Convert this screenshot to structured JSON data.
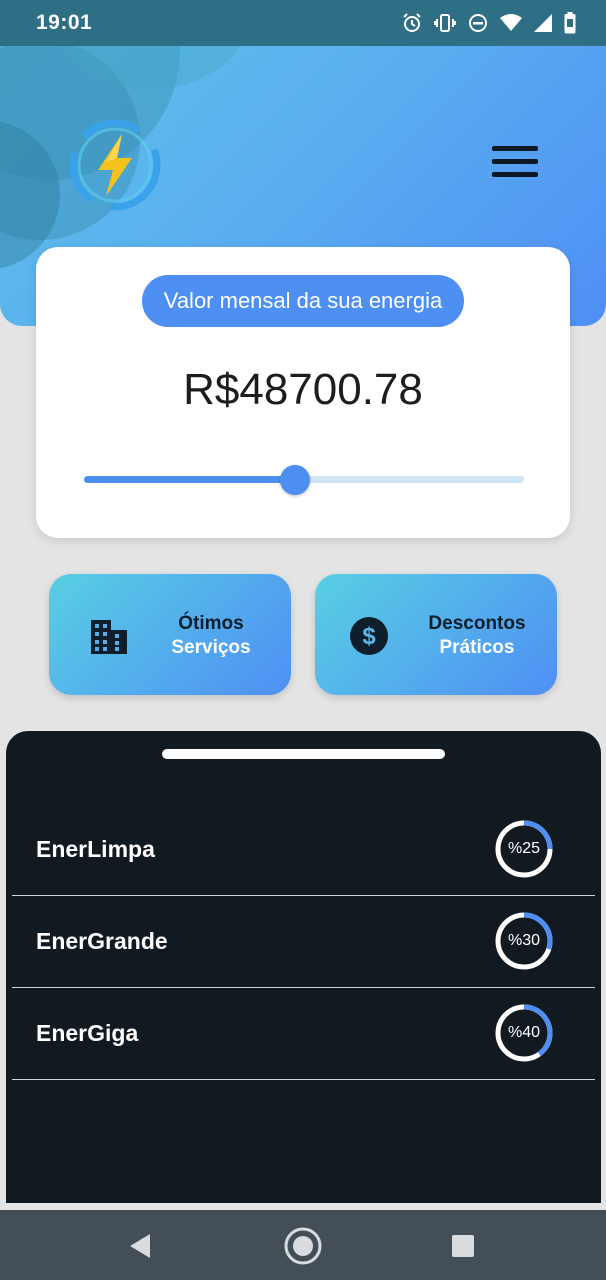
{
  "status_bar": {
    "time": "19:01",
    "icons": [
      "alarm-icon",
      "vibrate-icon",
      "do-not-disturb-icon",
      "wifi-icon",
      "signal-icon",
      "battery-icon"
    ]
  },
  "header": {
    "logo": "lightning-bolt-icon",
    "menu_icon": "hamburger-menu-icon"
  },
  "energy_card": {
    "label": "Valor mensal da sua energia",
    "value": "R$48700.78",
    "slider_fraction": 0.48
  },
  "features": [
    {
      "line1": "Ótimos",
      "line2": "Serviços",
      "icon": "building-icon"
    },
    {
      "line1": "Descontos",
      "line2": "Práticos",
      "icon": "dollar-icon"
    }
  ],
  "companies": [
    {
      "name": "EnerLimpa",
      "percent_label": "%25",
      "percent": 25
    },
    {
      "name": "EnerGrande",
      "percent_label": "%30",
      "percent": 30
    },
    {
      "name": "EnerGiga",
      "percent_label": "%40",
      "percent": 40
    }
  ],
  "colors": {
    "accent": "#4d8ff3",
    "header_gradient_start": "#5ec4e6",
    "sheet_background": "#121a21",
    "ring_progress": "#4f8ff5"
  }
}
